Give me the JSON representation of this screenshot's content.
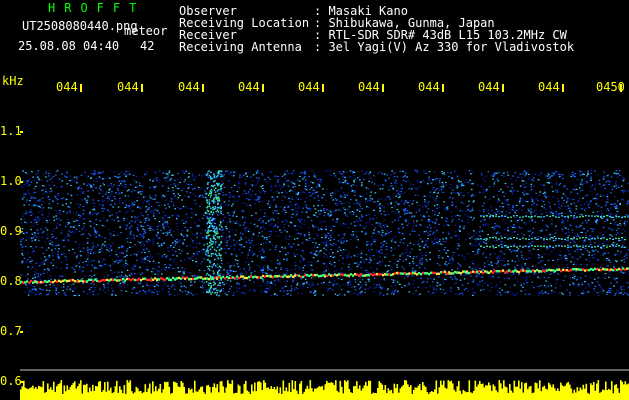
{
  "header": {
    "app_name": "HROFFT",
    "file_name": "UT2508080440.png",
    "event_type": "meteor",
    "datetime": "25.08.08 04:40",
    "count": "42",
    "info_labels": [
      "Observer",
      "Receiving Location",
      "Receiver",
      "Receiving Antenna"
    ],
    "info_values": [
      ": Masaki Kano",
      ": Shibukawa, Gunma, Japan",
      ": RTL-SDR SDR# 43dB L15 103.2MHz CW",
      ": 3el Yagi(V) Az 330 for Vladivostok"
    ]
  },
  "time_axis": {
    "labels": [
      "044",
      "044",
      "044",
      "044",
      "044",
      "044",
      "044",
      "044",
      "044",
      "0450"
    ]
  },
  "freq_axis": {
    "unit": "kHz",
    "labels": [
      "1.1",
      "1.0",
      "0.9",
      "0.8",
      "0.7",
      "0.6"
    ]
  },
  "colors": {
    "background": "#000000",
    "text": "#ffffff",
    "axis_labels": "#ffff00",
    "title": "#00ff00",
    "gridline": "#c8c8c8",
    "noise_dim": "#0a1fa8",
    "noise_mid": "#1a66ff",
    "noise_bright": "#3ad0ff",
    "signal_hot": "#ff2a2a",
    "signal_warm": "#f0e040",
    "signal_green": "#40ff80",
    "bottom_bar": "#ffff00"
  }
}
